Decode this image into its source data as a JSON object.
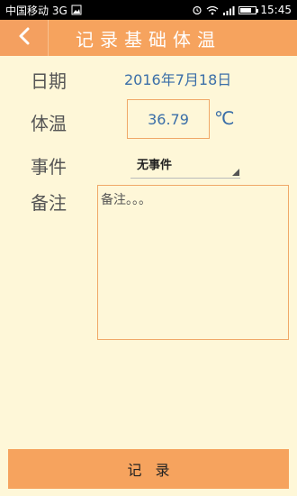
{
  "status_bar": {
    "carrier": "中国移动 3G",
    "time": "15:45"
  },
  "header": {
    "title": "记录基础体温"
  },
  "form": {
    "date_label": "日期",
    "date_value": "2016年7月18日",
    "temp_label": "体温",
    "temp_value": "36.79",
    "temp_unit": "℃",
    "event_label": "事件",
    "event_value": "无事件",
    "notes_label": "备注",
    "notes_placeholder": "备注。。。"
  },
  "footer": {
    "record_label": "记录"
  },
  "colors": {
    "accent": "#f6a35e",
    "background": "#fef7d8",
    "value_text": "#3a6ea8"
  }
}
